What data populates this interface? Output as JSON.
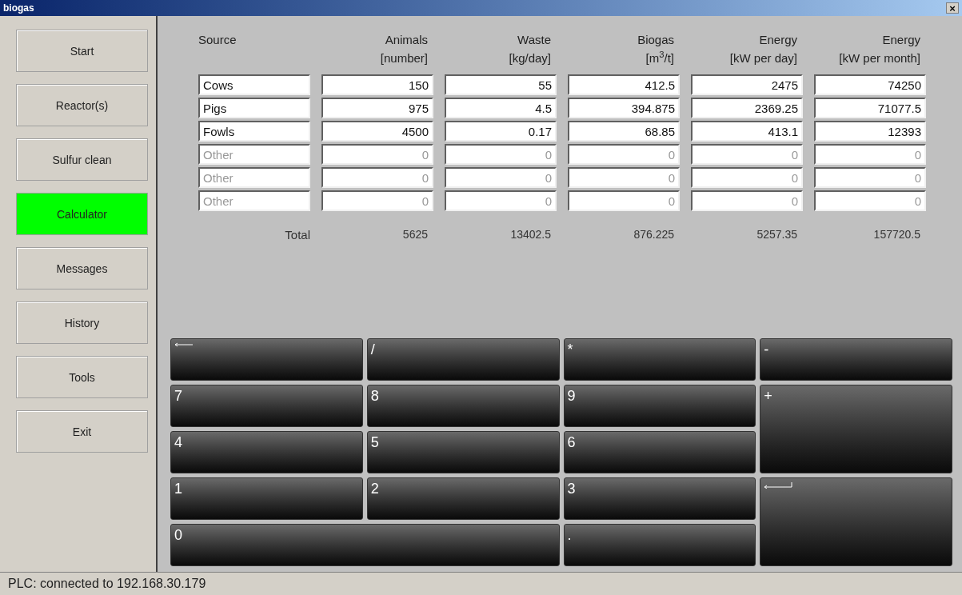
{
  "window": {
    "title": "biogas",
    "close": "×"
  },
  "sidebar": {
    "items": [
      {
        "label": "Start",
        "selected": false
      },
      {
        "label": "Reactor(s)",
        "selected": false
      },
      {
        "label": "Sulfur clean",
        "selected": false
      },
      {
        "label": "Calculator",
        "selected": true
      },
      {
        "label": "Messages",
        "selected": false
      },
      {
        "label": "History",
        "selected": false
      },
      {
        "label": "Tools",
        "selected": false
      },
      {
        "label": "Exit",
        "selected": false
      }
    ]
  },
  "table": {
    "columns": [
      {
        "title": "Source"
      },
      {
        "title": "Animals",
        "unit": "[number]"
      },
      {
        "title": "Waste",
        "unit": "[kg/day]"
      },
      {
        "title": "Biogas",
        "unit": "[m$^{3}$/t]"
      },
      {
        "title": "Energy",
        "unit": "[kW per day]"
      },
      {
        "title": "Energy",
        "unit": "[kW per month]"
      }
    ],
    "rows": [
      {
        "disabled": false,
        "cells": [
          "Cows",
          "150",
          "55",
          "412.5",
          "2475",
          "74250"
        ]
      },
      {
        "disabled": false,
        "cells": [
          "Pigs",
          "975",
          "4.5",
          "394.875",
          "2369.25",
          "71077.5"
        ]
      },
      {
        "disabled": false,
        "cells": [
          "Fowls",
          "4500",
          "0.17",
          "68.85",
          "413.1",
          "12393"
        ]
      },
      {
        "disabled": true,
        "cells": [
          "Other",
          "0",
          "0",
          "0",
          "0",
          "0"
        ]
      },
      {
        "disabled": true,
        "cells": [
          "Other",
          "0",
          "0",
          "0",
          "0",
          "0"
        ]
      },
      {
        "disabled": true,
        "cells": [
          "Other",
          "0",
          "0",
          "0",
          "0",
          "0"
        ]
      }
    ],
    "total": {
      "label": "Total",
      "values": [
        "5625",
        "13402.5",
        "876.225",
        "5257.35",
        "157720.5"
      ]
    }
  },
  "keypad": [
    {
      "kind": "backspace"
    },
    {
      "kind": "key",
      "label": "/"
    },
    {
      "kind": "key",
      "label": "*"
    },
    {
      "kind": "key",
      "label": "-"
    },
    {
      "kind": "key",
      "label": "7"
    },
    {
      "kind": "key",
      "label": "8"
    },
    {
      "kind": "key",
      "label": "9"
    },
    {
      "kind": "tall",
      "label": "+"
    },
    {
      "kind": "key",
      "label": "4"
    },
    {
      "kind": "key",
      "label": "5"
    },
    {
      "kind": "key",
      "label": "6"
    },
    {
      "kind": "key",
      "label": "1"
    },
    {
      "kind": "key",
      "label": "2"
    },
    {
      "kind": "key",
      "label": "3"
    },
    {
      "kind": "enter"
    },
    {
      "kind": "wide",
      "label": "0"
    },
    {
      "kind": "key",
      "label": "."
    }
  ],
  "status_bar": {
    "text": "PLC: connected to 192.168.30.179"
  }
}
